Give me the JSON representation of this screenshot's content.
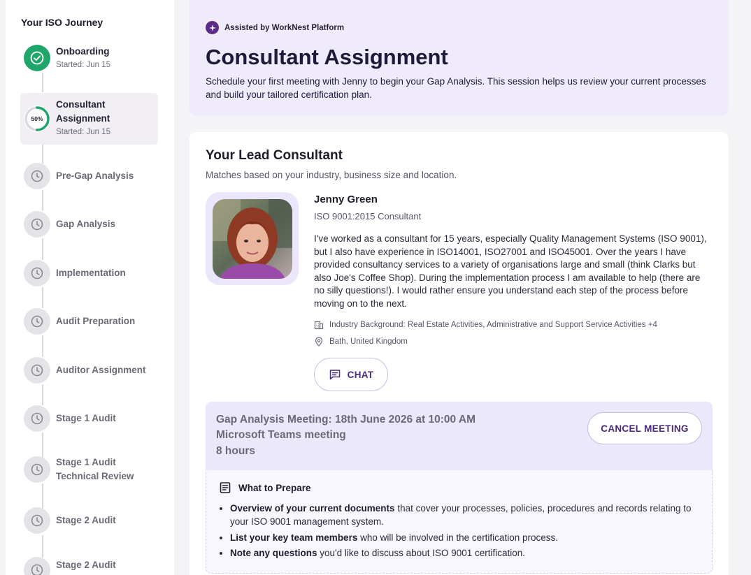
{
  "sidebar": {
    "title": "Your ISO Journey",
    "steps": [
      {
        "label": "Onboarding",
        "sub": "Started: Jun 15",
        "status": "done"
      },
      {
        "label": "Consultant Assignment",
        "sub": "Started: Jun 15",
        "status": "in-progress",
        "progress_text": "50%",
        "progress": 0.5
      },
      {
        "label": "Pre-Gap Analysis",
        "status": "pending"
      },
      {
        "label": "Gap Analysis",
        "status": "pending"
      },
      {
        "label": "Implementation",
        "status": "pending"
      },
      {
        "label": "Audit Preparation",
        "status": "pending"
      },
      {
        "label": "Auditor Assignment",
        "status": "pending"
      },
      {
        "label": "Stage 1 Audit",
        "status": "pending"
      },
      {
        "label": "Stage 1 Audit Technical Review",
        "status": "pending"
      },
      {
        "label": "Stage 2 Audit",
        "status": "pending"
      },
      {
        "label": "Stage 2 Audit",
        "status": "pending"
      }
    ]
  },
  "banner": {
    "assist_label": "Assisted by WorkNest Platform",
    "title": "Consultant Assignment",
    "description": "Schedule your first meeting with Jenny to begin your Gap Analysis. This session helps us review your current processes and build your tailored certification plan."
  },
  "consultant_card": {
    "title": "Your Lead Consultant",
    "subtitle": "Matches based on your industry, business size and location.",
    "name": "Jenny Green",
    "role": "ISO 9001:2015 Consultant",
    "bio": "I've worked as a consultant for 15 years, especially Quality Management Systems (ISO 9001), but I also have experience in ISO14001, ISO27001 and ISO45001. Over the years I have provided consultancy services to a variety of organisations large and small (think Clarks but also Joe's Coffee Shop). During the implementation process I am available to help (there are no silly questions!). I would rather ensure you understand each step of the process before moving on to the next.",
    "industry": "Industry Background: Real Estate Activities, Administrative and Support Service Activities +4",
    "location": "Bath, United Kingdom",
    "chat_label": "CHAT"
  },
  "meeting": {
    "line1": "Gap Analysis Meeting: 18th June 2026 at 10:00 AM",
    "line2": "Microsoft Teams meeting",
    "line3": "8 hours",
    "cancel_label": "CANCEL MEETING"
  },
  "prepare": {
    "heading": "What to Prepare",
    "items": [
      {
        "bold": "Overview of your current documents",
        "rest": " that cover your processes, policies, procedures and records relating to your ISO 9001 management system."
      },
      {
        "bold": "List your key team members",
        "rest": " who will be involved in the certification process."
      },
      {
        "bold": "Note any questions",
        "rest": " you'd like to discuss about ISO 9001 certification."
      }
    ]
  },
  "colors": {
    "accent": "#5b2d86",
    "success": "#20a56b",
    "banner_bg": "#efebfb"
  },
  "icons": [
    "check-icon",
    "clock-icon",
    "sparkle-icon",
    "building-icon",
    "location-pin-icon",
    "chat-icon",
    "document-icon"
  ]
}
